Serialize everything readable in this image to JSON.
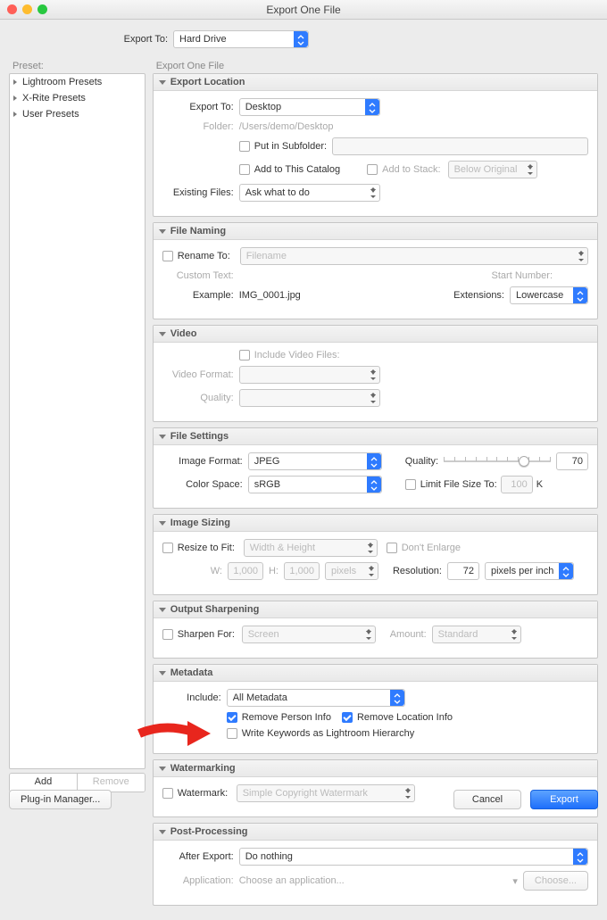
{
  "window": {
    "title": "Export One File"
  },
  "exportTo": {
    "label": "Export To:",
    "value": "Hard Drive"
  },
  "preset": {
    "heading": "Preset:",
    "items": [
      "Lightroom Presets",
      "X-Rite Presets",
      "User Presets"
    ],
    "add": "Add",
    "remove": "Remove"
  },
  "rightHeading": "Export One File",
  "sections": {
    "exportLocation": {
      "title": "Export Location",
      "exportTo_label": "Export To:",
      "exportTo_value": "Desktop",
      "folder_label": "Folder:",
      "folder_value": "/Users/demo/Desktop",
      "putInSubfolder": "Put in Subfolder:",
      "addToCatalog": "Add to This Catalog",
      "addToStack": "Add to Stack:",
      "stackPos": "Below Original",
      "existing_label": "Existing Files:",
      "existing_value": "Ask what to do"
    },
    "fileNaming": {
      "title": "File Naming",
      "renameTo": "Rename To:",
      "renameTemplate": "Filename",
      "customText_label": "Custom Text:",
      "startNumber_label": "Start Number:",
      "example_label": "Example:",
      "example_value": "IMG_0001.jpg",
      "extensions_label": "Extensions:",
      "extensions_value": "Lowercase"
    },
    "video": {
      "title": "Video",
      "include": "Include Video Files:",
      "format_label": "Video Format:",
      "quality_label": "Quality:"
    },
    "fileSettings": {
      "title": "File Settings",
      "format_label": "Image Format:",
      "format_value": "JPEG",
      "quality_label": "Quality:",
      "quality_value": "70",
      "colorspace_label": "Color Space:",
      "colorspace_value": "sRGB",
      "limit_label": "Limit File Size To:",
      "limit_value": "100",
      "limit_unit": "K"
    },
    "imageSizing": {
      "title": "Image Sizing",
      "resize": "Resize to Fit:",
      "resize_value": "Width & Height",
      "dontEnlarge": "Don't Enlarge",
      "w_label": "W:",
      "w_value": "1,000",
      "h_label": "H:",
      "h_value": "1,000",
      "unit": "pixels",
      "resolution_label": "Resolution:",
      "resolution_value": "72",
      "resolution_unit": "pixels per inch"
    },
    "sharpening": {
      "title": "Output Sharpening",
      "sharpenFor": "Sharpen For:",
      "sharpen_value": "Screen",
      "amount_label": "Amount:",
      "amount_value": "Standard"
    },
    "metadata": {
      "title": "Metadata",
      "include_label": "Include:",
      "include_value": "All Metadata",
      "removePerson": "Remove Person Info",
      "removeLocation": "Remove Location Info",
      "writeKeywords": "Write Keywords as Lightroom Hierarchy"
    },
    "watermarking": {
      "title": "Watermarking",
      "watermark": "Watermark:",
      "watermark_value": "Simple Copyright Watermark"
    },
    "postProcessing": {
      "title": "Post-Processing",
      "after_label": "After Export:",
      "after_value": "Do nothing",
      "app_label": "Application:",
      "app_value": "Choose an application...",
      "choose": "Choose..."
    }
  },
  "footer": {
    "pluginManager": "Plug-in Manager...",
    "cancel": "Cancel",
    "export": "Export"
  }
}
